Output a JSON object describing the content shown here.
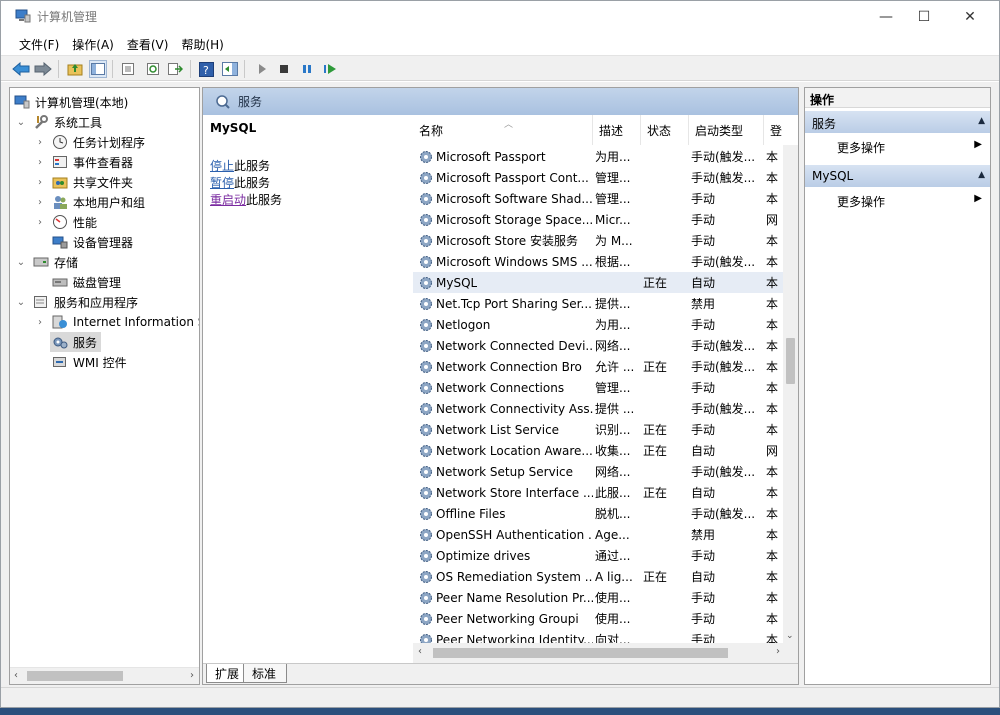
{
  "window": {
    "title": "计算机管理",
    "minimize": "—",
    "maximize": "☐",
    "close": "✕"
  },
  "menu": [
    "文件(F)",
    "操作(A)",
    "查看(V)",
    "帮助(H)"
  ],
  "tree": {
    "root": "计算机管理(本地)",
    "system_tools": "系统工具",
    "task_scheduler": "任务计划程序",
    "event_viewer": "事件查看器",
    "shared_folders": "共享文件夹",
    "local_users": "本地用户和组",
    "performance": "性能",
    "device_manager": "设备管理器",
    "storage": "存储",
    "disk_management": "磁盘管理",
    "services_apps": "服务和应用程序",
    "iis": "Internet Information S",
    "services": "服务",
    "wmi": "WMI 控件"
  },
  "center": {
    "header": "服务",
    "selected_service": "MySQL",
    "actions": [
      {
        "link": "停止",
        "suffix": "此服务"
      },
      {
        "link": "暂停",
        "suffix": "此服务"
      },
      {
        "link": "重启动",
        "suffix": "此服务"
      }
    ],
    "columns": [
      "名称",
      "描述",
      "状态",
      "启动类型",
      "登"
    ],
    "rows": [
      [
        "Microsoft Passport",
        "为用...",
        "",
        "手动(触发...",
        "本"
      ],
      [
        "Microsoft Passport Cont...",
        "管理...",
        "",
        "手动(触发...",
        "本"
      ],
      [
        "Microsoft Software Shad...",
        "管理...",
        "",
        "手动",
        "本"
      ],
      [
        "Microsoft Storage Space...",
        "Micr...",
        "",
        "手动",
        "网"
      ],
      [
        "Microsoft Store 安装服务",
        "为 M...",
        "",
        "手动",
        "本"
      ],
      [
        "Microsoft Windows SMS ...",
        "根据...",
        "",
        "手动(触发...",
        "本"
      ],
      [
        "MySQL",
        "",
        "正在",
        "自动",
        "本"
      ],
      [
        "Net.Tcp Port Sharing Ser...",
        "提供...",
        "",
        "禁用",
        "本"
      ],
      [
        "Netlogon",
        "为用...",
        "",
        "手动",
        "本"
      ],
      [
        "Network Connected Devi...",
        "网络...",
        "",
        "手动(触发...",
        "本"
      ],
      [
        "Network Connection Bro",
        "允许 ...",
        "正在",
        "手动(触发...",
        "本"
      ],
      [
        "Network Connections",
        "管理...",
        "",
        "手动",
        "本"
      ],
      [
        "Network Connectivity Ass...",
        "提供 ...",
        "",
        "手动(触发...",
        "本"
      ],
      [
        "Network List Service",
        "识别...",
        "正在",
        "手动",
        "本"
      ],
      [
        "Network Location Aware...",
        "收集...",
        "正在",
        "自动",
        "网"
      ],
      [
        "Network Setup Service",
        "网络...",
        "",
        "手动(触发...",
        "本"
      ],
      [
        "Network Store Interface ...",
        "此服...",
        "正在",
        "自动",
        "本"
      ],
      [
        "Offline Files",
        "脱机...",
        "",
        "手动(触发...",
        "本"
      ],
      [
        "OpenSSH Authentication ...",
        "Age...",
        "",
        "禁用",
        "本"
      ],
      [
        "Optimize drives",
        "通过...",
        "",
        "手动",
        "本"
      ],
      [
        "OS Remediation System ...",
        "A lig...",
        "正在",
        "自动",
        "本"
      ],
      [
        "Peer Name Resolution Pr...",
        "使用...",
        "",
        "手动",
        "本"
      ],
      [
        "Peer Networking Groupi",
        "使用...",
        "",
        "手动",
        "本"
      ],
      [
        "Peer Networking Identity...",
        "向对...",
        "",
        "手动",
        "本"
      ]
    ],
    "tabs": [
      "扩展",
      "标准"
    ]
  },
  "actions_pane": {
    "title": "操作",
    "sections": [
      {
        "label": "服务",
        "item": "更多操作"
      },
      {
        "label": "MySQL",
        "item": "更多操作"
      }
    ]
  },
  "colors": {
    "accent": "#2f6fb5",
    "header_grad": "#b6cae5",
    "link": "#2a5fad",
    "link_visited": "#7a2aa0"
  }
}
